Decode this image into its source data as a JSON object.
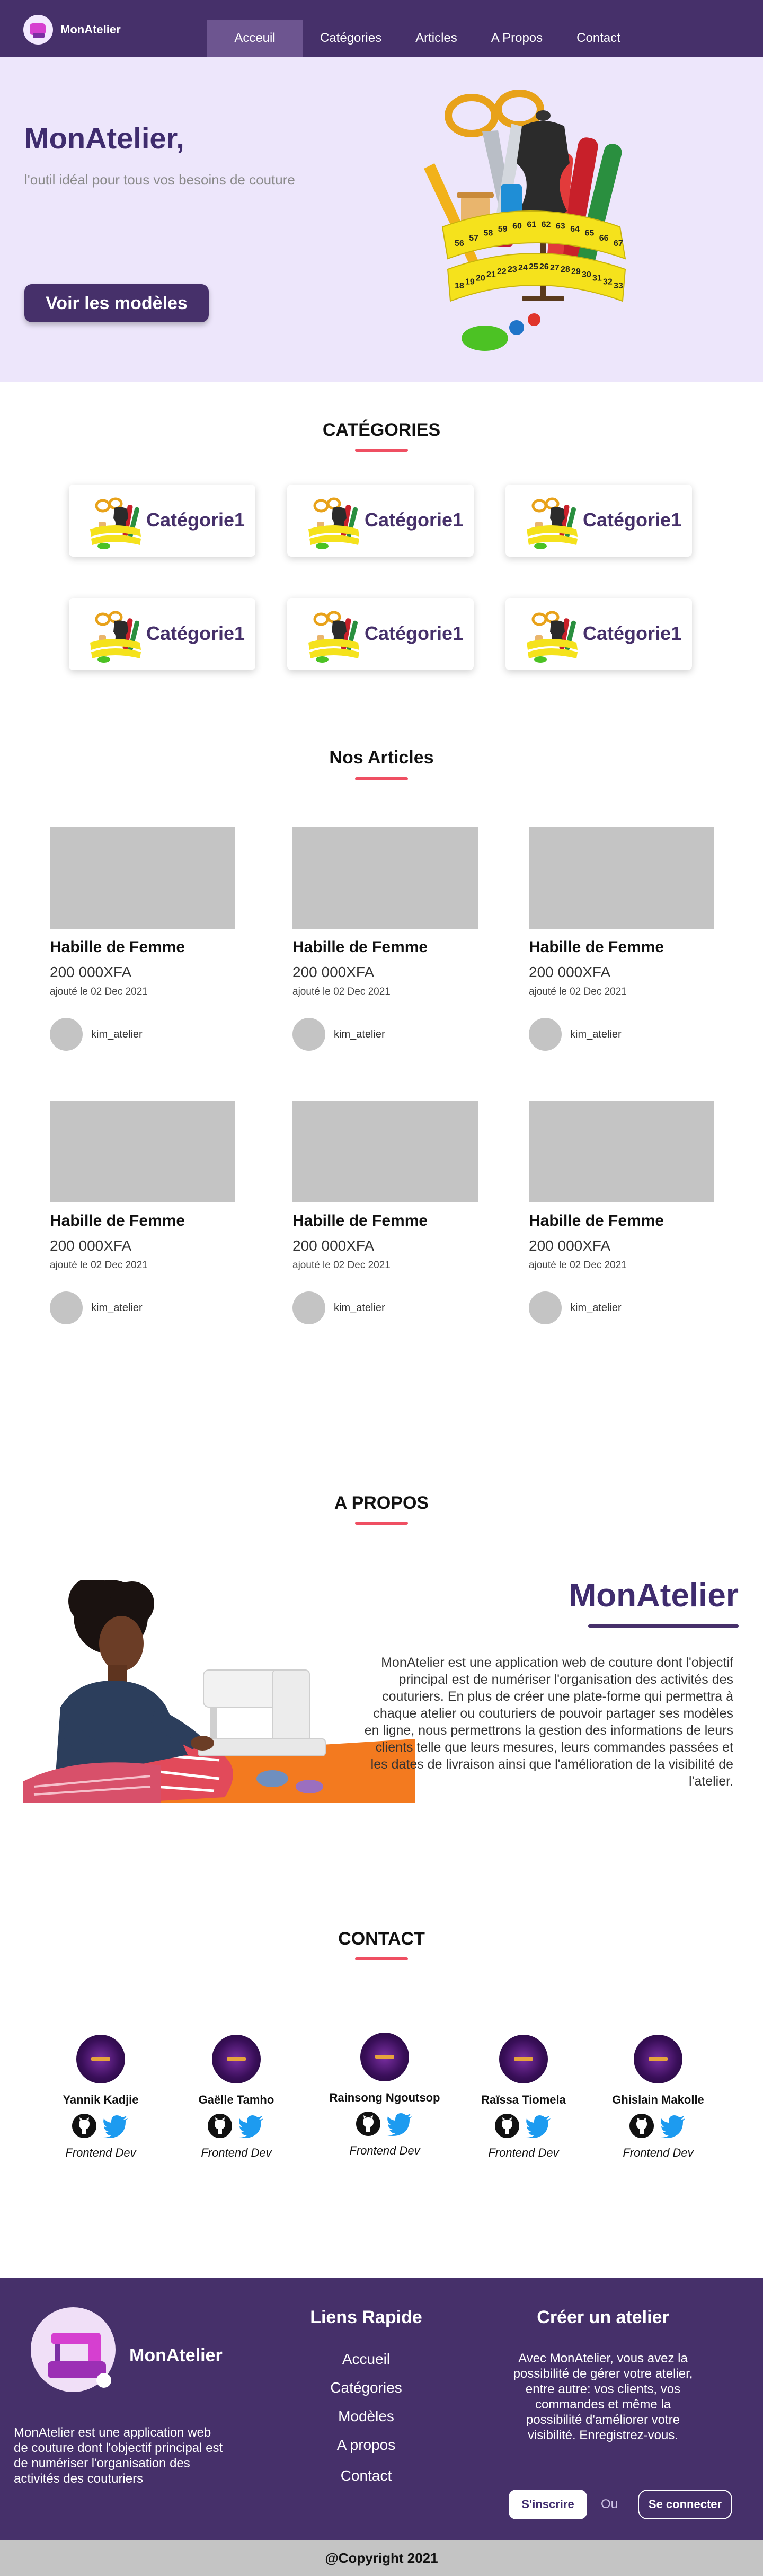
{
  "navbar": {
    "brand": "MonAtelier",
    "items": [
      {
        "label": "Acceuil",
        "active": true
      },
      {
        "label": "Catégories"
      },
      {
        "label": "Articles"
      },
      {
        "label": "A Propos"
      },
      {
        "label": "Contact"
      }
    ]
  },
  "hero": {
    "title": "MonAtelier,",
    "subtitle": "l'outil idéal pour tous vos besoins de couture",
    "button": "Voir les modèles",
    "tape_numbers": [
      "56",
      "57",
      "58",
      "59",
      "60",
      "61",
      "62",
      "63",
      "64",
      "65",
      "66",
      "67",
      "18",
      "19",
      "20",
      "21",
      "22",
      "23",
      "24",
      "25",
      "26",
      "27",
      "28",
      "29",
      "30",
      "31",
      "32",
      "33"
    ]
  },
  "categories": {
    "title": "CATÉGORIES",
    "items": [
      {
        "label": "Catégorie1"
      },
      {
        "label": "Catégorie1"
      },
      {
        "label": "Catégorie1"
      },
      {
        "label": "Catégorie1"
      },
      {
        "label": "Catégorie1"
      },
      {
        "label": "Catégorie1"
      }
    ]
  },
  "articles": {
    "title": "Nos Articles",
    "items": [
      {
        "title": "Habille de Femme",
        "price": "200 000XFA",
        "date": "ajouté le 02 Dec 2021",
        "user": "kim_atelier"
      },
      {
        "title": "Habille de Femme",
        "price": "200 000XFA",
        "date": "ajouté le 02 Dec 2021",
        "user": "kim_atelier"
      },
      {
        "title": "Habille de Femme",
        "price": "200 000XFA",
        "date": "ajouté le 02 Dec 2021",
        "user": "kim_atelier"
      },
      {
        "title": "Habille de Femme",
        "price": "200 000XFA",
        "date": "ajouté le 02 Dec 2021",
        "user": "kim_atelier"
      },
      {
        "title": "Habille de Femme",
        "price": "200 000XFA",
        "date": "ajouté le 02 Dec 2021",
        "user": "kim_atelier"
      },
      {
        "title": "Habille de Femme",
        "price": "200 000XFA",
        "date": "ajouté le 02 Dec 2021",
        "user": "kim_atelier"
      }
    ]
  },
  "about": {
    "title": "A PROPOS",
    "name": "MonAtelier",
    "text": "MonAtelier est une application web de couture dont l'objectif principal est de numériser l'organisation des activités des couturiers. En plus de créer une plate-forme qui permettra à chaque atelier ou couturiers de pouvoir partager ses modèles en ligne, nous permettrons la gestion des informations de leurs clients telle que leurs mesures, leurs commandes passées et les dates de livraison ainsi que l'amélioration de la visibilité de l'atelier."
  },
  "contact": {
    "title": "CONTACT",
    "members": [
      {
        "name": "Yannik Kadjie",
        "role": "Frontend Dev",
        "icons": [
          "github-icon",
          "twitter-icon"
        ]
      },
      {
        "name": "Gaëlle Tamho",
        "role": "Frontend Dev",
        "icons": [
          "github-icon",
          "twitter-icon"
        ]
      },
      {
        "name": "Rainsong Ngoutsop",
        "role": "Frontend Dev",
        "icons": [
          "github-icon",
          "twitter-icon"
        ]
      },
      {
        "name": "Raïssa Tiomela",
        "role": "Frontend Dev",
        "icons": [
          "github-icon",
          "twitter-icon"
        ]
      },
      {
        "name": "Ghislain Makolle",
        "role": "Frontend Dev",
        "icons": [
          "github-icon",
          "twitter-icon"
        ]
      }
    ]
  },
  "footer": {
    "brand": "MonAtelier",
    "about": "MonAtelier est une application web de couture dont l'objectif principal est de numériser l'organisation des activités des couturiers",
    "links_title": "Liens Rapide",
    "links": [
      "Accueil",
      "Catégories",
      "Modèles",
      "A propos",
      "Contact"
    ],
    "create_title": "Créer un atelier",
    "create_text": "Avec MonAtelier, vous avez la possibilité de gérer votre atelier, entre autre: vos clients, vos commandes et même la possibilité d'améliorer votre visibilité. Enregistrez-vous.",
    "signup_button": "S'inscrire",
    "or_label": "Ou",
    "login_button": "Se connecter",
    "copyright": "@Copyright 2021"
  },
  "colors": {
    "primary": "#46306a",
    "hero_bg": "#ede6fb",
    "accent": "#ef4f62",
    "placeholder": "#c4c4c4"
  }
}
